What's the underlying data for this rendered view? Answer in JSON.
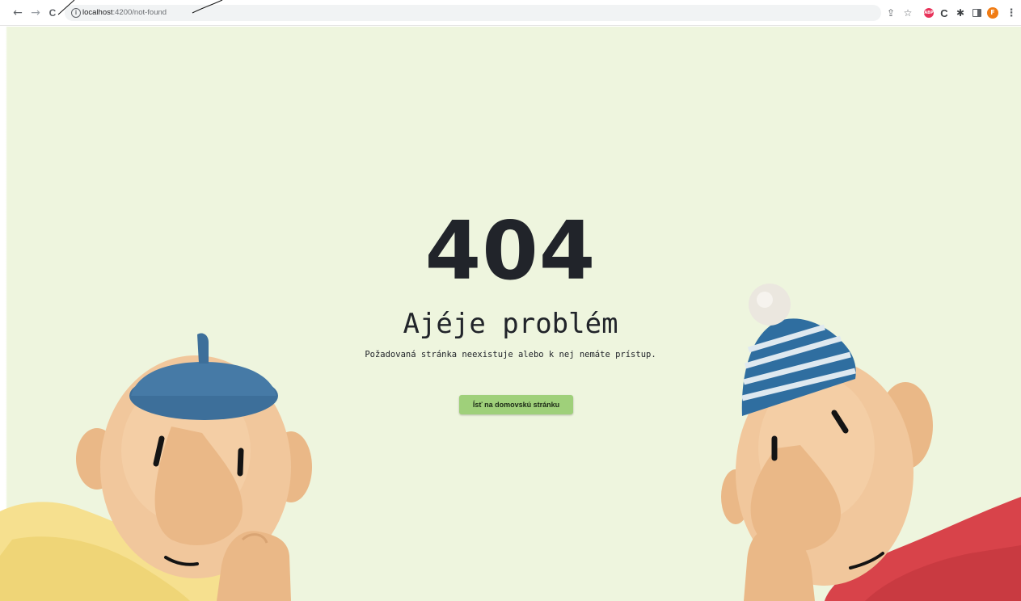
{
  "browser": {
    "url_host": "localhost",
    "url_path": ":4200/not-found",
    "nav": {
      "back_glyph": "←",
      "forward_glyph": "→",
      "reload_glyph": "C"
    },
    "toolbar": {
      "share_glyph": "⇪",
      "bookmark_glyph": "☆",
      "extension_label": "ABP",
      "extension_c_glyph": "C",
      "extensions_glyph": "✱",
      "profile_initial": "F",
      "menu_glyph": "⋮"
    },
    "colors": {
      "chrome_bg": "#ffffff",
      "omnibox_bg": "#f1f3f4",
      "avatar": "#f07c14",
      "extension_red": "#e8335a"
    }
  },
  "page": {
    "error_code": "404",
    "title": "Ajéje problém",
    "message": "Požadovaná stránka neexistuje alebo k nej nemáte prístup.",
    "home_button": "Ísť na domovskú stránku",
    "colors": {
      "background": "#eef5de",
      "text": "#21242a",
      "button": "#9fd07a"
    },
    "illustrations": {
      "left": "character-blue-beret-yellow-sweater",
      "right": "character-striped-beanie-red-sweater"
    }
  }
}
